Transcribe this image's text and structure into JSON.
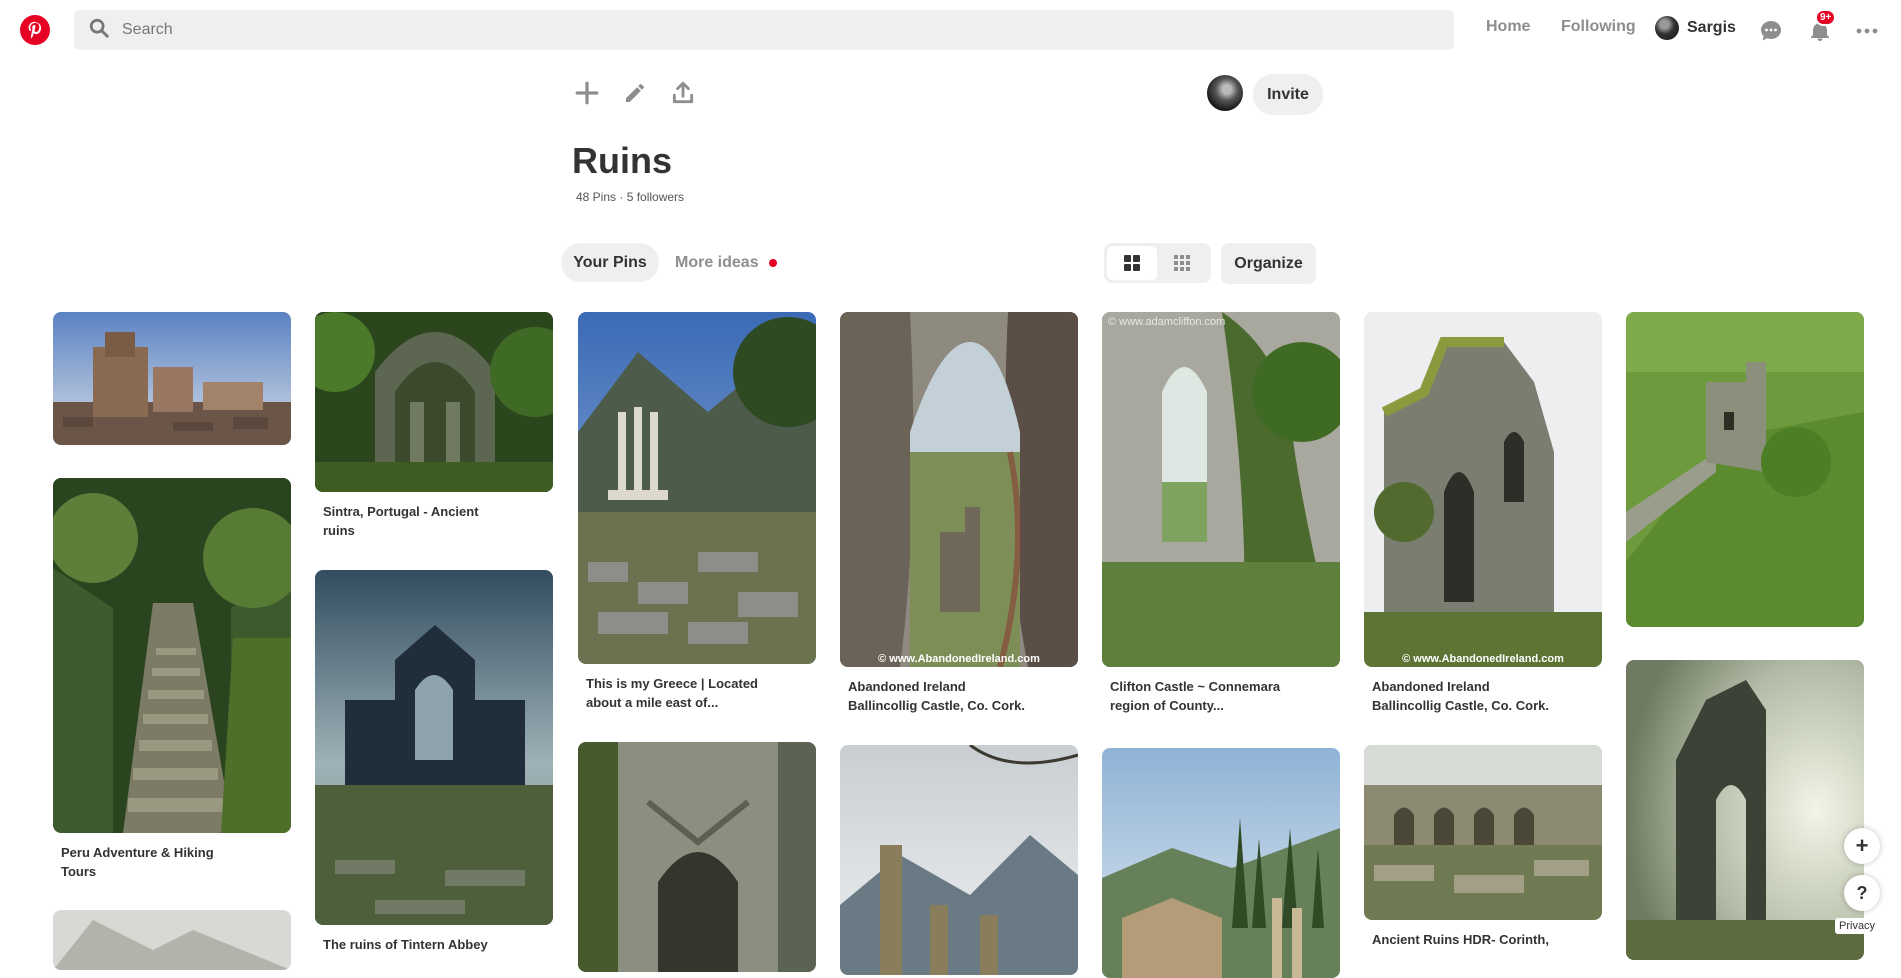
{
  "header": {
    "logo_icon": "pinterest-logo",
    "search": {
      "placeholder": "Search",
      "icon": "search-icon"
    },
    "nav": {
      "home": "Home",
      "following": "Following"
    },
    "profile": {
      "name": "Sargis"
    },
    "notifications_badge": "9+",
    "brand_color": "#e60023"
  },
  "board": {
    "tools": [
      "plus-icon",
      "pencil-icon",
      "share-icon"
    ],
    "invite_label": "Invite",
    "title": "Ruins",
    "meta": "48 Pins · 5 followers"
  },
  "tabs": {
    "your_pins": "Your Pins",
    "more_ideas": "More ideas"
  },
  "view_controls": {
    "default_view_icon": "grid-large-icon",
    "compact_view_icon": "grid-small-icon",
    "active": "default",
    "organize_label": "Organize"
  },
  "pins": [
    {
      "title": ""
    },
    {
      "title": "Peru Adventure & Hiking Tours"
    },
    {
      "title": ""
    },
    {
      "title": "Sintra, Portugal - Ancient ruins"
    },
    {
      "title": "The ruins of Tintern Abbey"
    },
    {
      "title": "This is my Greece | Located about a mile east of..."
    },
    {
      "title": ""
    },
    {
      "title": "Abandoned Ireland Ballincollig Castle, Co. Cork.",
      "watermark": "© www.AbandonedIreland.com"
    },
    {
      "title": ""
    },
    {
      "title": "Clifton Castle ~ Connemara region of County...",
      "watermark": "© www.adamcliffon.com"
    },
    {
      "title": ""
    },
    {
      "title": "Abandoned Ireland Ballincollig Castle, Co. Cork.",
      "watermark": "© www.AbandonedIreland.com"
    },
    {
      "title": "Ancient Ruins HDR- Corinth,"
    },
    {
      "title": ""
    },
    {
      "title": ""
    }
  ],
  "floating": {
    "plus": "+",
    "help": "?",
    "privacy": "Privacy"
  }
}
